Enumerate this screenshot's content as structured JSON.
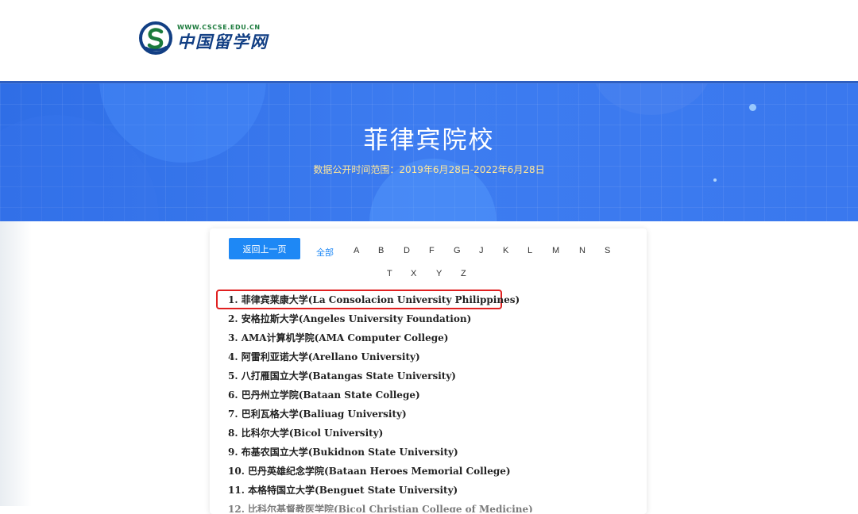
{
  "header": {
    "logo_url": "WWW.CSCSE.EDU.CN",
    "logo_name": "中国留学网"
  },
  "banner": {
    "title": "菲律宾院校",
    "subtitle": "数据公开时间范围：2019年6月28日-2022年6月28日"
  },
  "nav": {
    "back_label": "返回上一页",
    "all_label": "全部",
    "letters_row1": [
      "A",
      "B",
      "D",
      "F",
      "G",
      "J",
      "K",
      "L",
      "M",
      "N",
      "S"
    ],
    "letters_row2": [
      "T",
      "X",
      "Y",
      "Z"
    ]
  },
  "universities": [
    "1.  菲律宾莱康大学(La Consolacion University Philippines)",
    "2.  安格拉斯大学(Angeles University Foundation)",
    "3.  AMA计算机学院(AMA Computer College)",
    "4.  阿雷利亚诺大学(Arellano University)",
    "5.  八打雁国立大学(Batangas State University)",
    "6.  巴丹州立学院(Bataan State College)",
    "7.  巴利瓦格大学(Baliuag University)",
    "8.  比科尔大学(Bicol University)",
    "9.  布基农国立大学(Bukidnon State University)",
    "10.  巴丹英雄纪念学院(Bataan Heroes Memorial College)",
    "11.  本格特国立大学(Benguet State University)",
    "12.  比科尔基督教医学院(Bicol Christian College of Medicine)"
  ],
  "colors": {
    "banner_blue": "#3d7cf0",
    "button_blue": "#1e88f5",
    "highlight_red": "#e02020",
    "subtitle_yellow": "#ffe79a"
  }
}
